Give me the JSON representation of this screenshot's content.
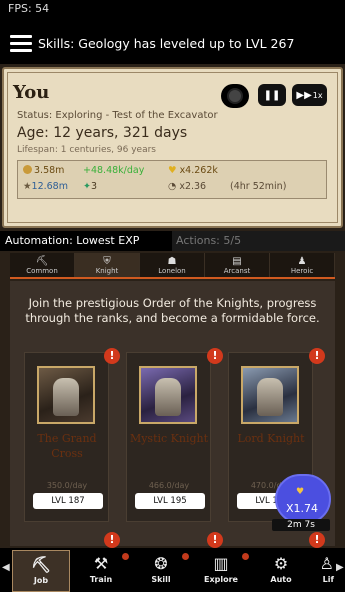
{
  "fps": "FPS: 54",
  "notice": "Skills: Geology has leveled up to LVL 267",
  "character": {
    "name": "You",
    "status": "Status: Exploring - Test of the Excavator",
    "age": "Age: 12 years, 321 days",
    "lifespan": "Lifespan: 1 centuries, 96 years",
    "ff_label": "1x"
  },
  "stats": {
    "coins": "3.58m",
    "income": "+48.48k/day",
    "favor": "x4.262k",
    "stars": "12.68m",
    "sparks": "3",
    "multiplier": "x2.36",
    "duration": "(4hr 52min)"
  },
  "automation": "Automation: Lowest EXP",
  "actions": "Actions: 5/5",
  "categories": [
    "Common",
    "Knight",
    "Lonelon",
    "Arcanst",
    "Heroic"
  ],
  "intro": "Join the prestigious Order of the Knights, progress through the ranks, and become a formidable force.",
  "jobs": [
    {
      "name": "The Grand Cross",
      "pay": "350.0/day",
      "level": "LVL 187"
    },
    {
      "name": "Mystic Knight",
      "pay": "466.0/day",
      "level": "LVL 195"
    },
    {
      "name": "Lord Knight",
      "pay": "470.0/day",
      "level": "LVL 198"
    }
  ],
  "boost": {
    "value": "X1.74",
    "timer": "2m 7s"
  },
  "nav": [
    "Job",
    "Train",
    "Skill",
    "Explore",
    "Auto",
    "Lif"
  ],
  "colors": {
    "accent": "#d05a20",
    "boost": "#4b4fe0",
    "alert": "#d2391c"
  }
}
